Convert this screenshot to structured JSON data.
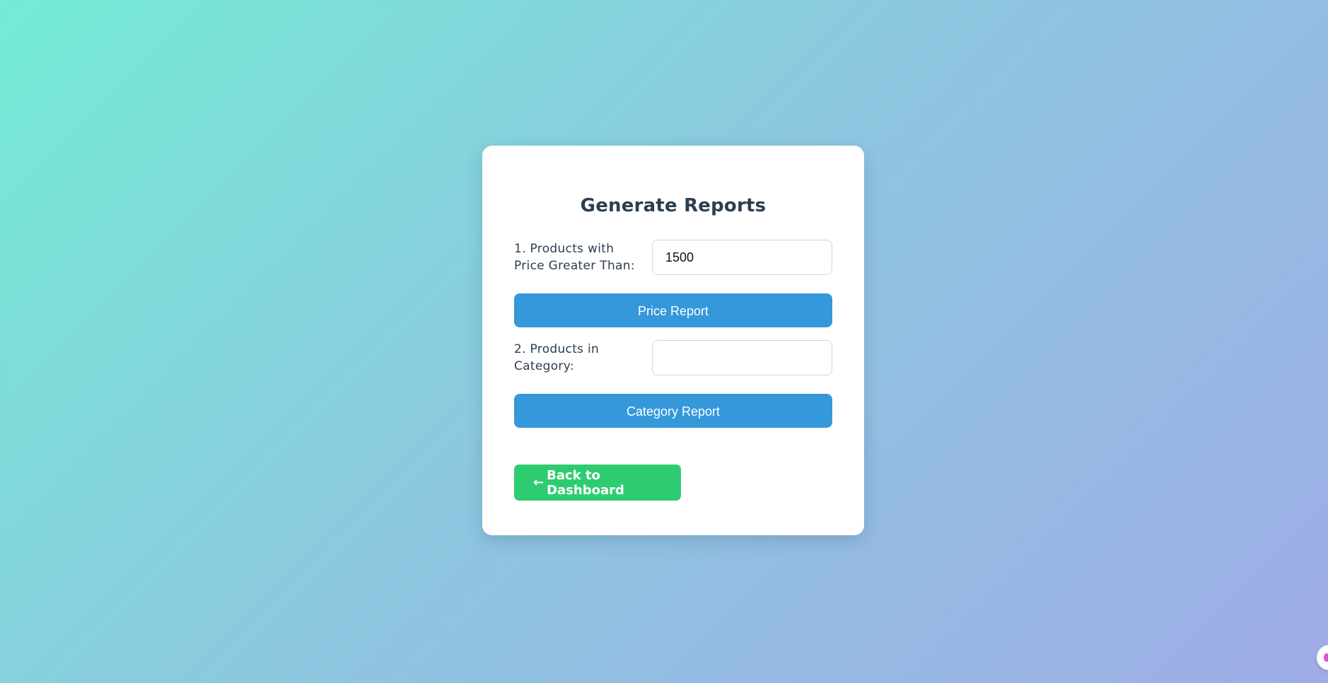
{
  "report": {
    "title": "Generate Reports",
    "price": {
      "label": "1. Products with Price Greater Than:",
      "value": "1500",
      "button_label": "Price Report"
    },
    "category": {
      "label": "2. Products in Category:",
      "value": "",
      "button_label": "Category Report"
    },
    "back": {
      "arrow": "←",
      "label": "Back to Dashboard"
    }
  },
  "colors": {
    "primary_button": "#3498db",
    "back_button": "#2ecc71",
    "heading_text": "#2c3e50"
  }
}
